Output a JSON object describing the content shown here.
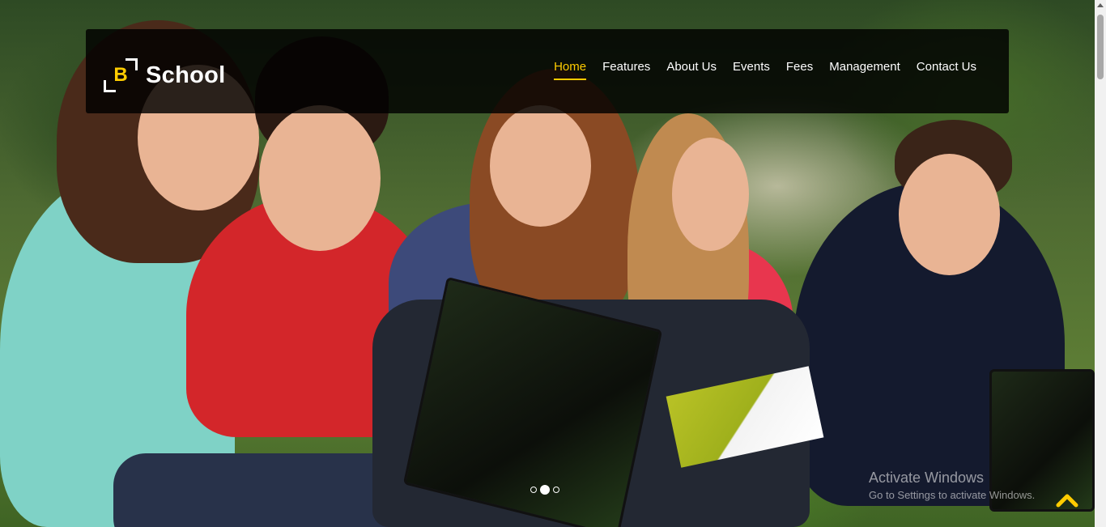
{
  "brand": {
    "logo_letter": "B",
    "name": "School",
    "accent_color": "#ffcc00"
  },
  "nav": {
    "items": [
      {
        "label": "Home",
        "active": true
      },
      {
        "label": "Features",
        "active": false
      },
      {
        "label": "About Us",
        "active": false
      },
      {
        "label": "Events",
        "active": false
      },
      {
        "label": "Fees",
        "active": false
      },
      {
        "label": "Management",
        "active": false
      },
      {
        "label": "Contact Us",
        "active": false
      }
    ]
  },
  "hero": {
    "image": "students-studying-on-grass-photo",
    "carousel": {
      "slide_count": 3,
      "active_index": 1
    }
  },
  "watermark": {
    "title": "Activate Windows",
    "subtitle": "Go to Settings to activate Windows."
  },
  "back_to_top": {
    "icon": "chevron-up-icon"
  }
}
